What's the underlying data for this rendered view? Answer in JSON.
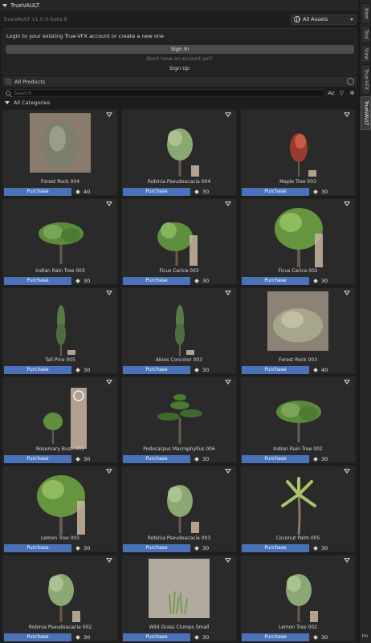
{
  "header": {
    "title": "TrueVAULT"
  },
  "version_text": "TrueVAULT v1.0.0-beta.9",
  "asset_filter": {
    "selected": "All Assets"
  },
  "login": {
    "message": "Login to your existing True-VFX account or create a new one",
    "sign_in_label": "Sign In",
    "no_account_text": "Don't have an account yet?",
    "sign_up_label": "Sign Up"
  },
  "products_toggle_label": "All Products",
  "search": {
    "placeholder": "Search",
    "sort_label": "Az"
  },
  "categories_label": "All Categories",
  "side_tabs": [
    "Item",
    "Tool",
    "View",
    "True-VFX",
    "TrueVAULT"
  ],
  "corner_text": "Ho",
  "colors": {
    "purchase": "#4a72b8",
    "card": "#2a2a2a",
    "background": "#1d1d1d"
  },
  "cards": [
    {
      "name": "Forest Rock 004",
      "price": "40",
      "purchase_label": "Purchase",
      "thumb": "rock"
    },
    {
      "name": "Robinia Pseudoacacia 004",
      "price": "30",
      "purchase_label": "Purchase",
      "thumb": "tree"
    },
    {
      "name": "Maple Tree 003",
      "price": "30",
      "purchase_label": "Purchase",
      "thumb": "redtree"
    },
    {
      "name": "Indian Rain Tree 003",
      "price": "30",
      "purchase_label": "Purchase",
      "thumb": "wide"
    },
    {
      "name": "Ficus Carica 003",
      "price": "30",
      "purchase_label": "Purchase",
      "thumb": "bush"
    },
    {
      "name": "Ficus Carica 002",
      "price": "30",
      "purchase_label": "Purchase",
      "thumb": "bigtree"
    },
    {
      "name": "Tall Pine 005",
      "price": "30",
      "purchase_label": "Purchase",
      "thumb": "pine"
    },
    {
      "name": "Abies Concolor 003",
      "price": "30",
      "purchase_label": "Purchase",
      "thumb": "pine"
    },
    {
      "name": "Forest Rock 003",
      "price": "40",
      "purchase_label": "Purchase",
      "thumb": "rock2"
    },
    {
      "name": "Rosemary Bush 005",
      "price": "30",
      "purchase_label": "Purchase",
      "thumb": "small"
    },
    {
      "name": "Podocarpus Macrophyllus 006",
      "price": "30",
      "purchase_label": "Purchase",
      "thumb": "bonsai"
    },
    {
      "name": "Indian Rain Tree 002",
      "price": "30",
      "purchase_label": "Purchase",
      "thumb": "wide"
    },
    {
      "name": "Lemon Tree 003",
      "price": "30",
      "purchase_label": "Purchase",
      "thumb": "bigtree"
    },
    {
      "name": "Robinia Pseudoacacia 003",
      "price": "30",
      "purchase_label": "Purchase",
      "thumb": "tree"
    },
    {
      "name": "Coconut Palm 005",
      "price": "30",
      "purchase_label": "Purchase",
      "thumb": "palm"
    },
    {
      "name": "Robinia Pseudoacacia 002",
      "price": "30",
      "purchase_label": "Purchase",
      "thumb": "tree"
    },
    {
      "name": "Wild Grass Clumps Small",
      "price": "30",
      "purchase_label": "Purchase",
      "thumb": "grass"
    },
    {
      "name": "Lemon Tree 002",
      "price": "30",
      "purchase_label": "Purchase",
      "thumb": "tree"
    }
  ]
}
